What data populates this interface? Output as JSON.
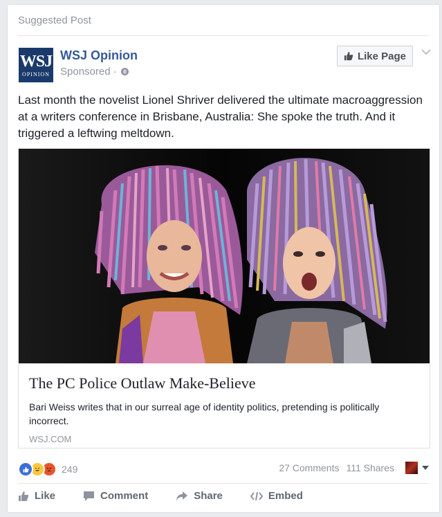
{
  "header": {
    "suggested_label": "Suggested Post"
  },
  "page": {
    "name": "WSJ Opinion",
    "logo_text": "WSJ",
    "logo_subtext": "OPINION",
    "sponsored_label": "Sponsored",
    "separator": "·",
    "like_page_label": "Like Page",
    "brand_color": "#365899",
    "logo_bg": "#1a3a6b"
  },
  "post": {
    "text": "Last month the novelist Lionel Shriver delivered the ultimate macroaggression at a writers conference in Brisbane, Australia: She spoke the truth. And it triggered a leftwing meltdown."
  },
  "link": {
    "title": "The PC Police Outlaw Make-Believe",
    "description": "Bari Weiss writes that in our surreal age of identity politics, pretending is politically incorrect.",
    "domain": "WSJ.COM",
    "image_icon": "photo-two-models-colorful-dreadlocks"
  },
  "engagement": {
    "reaction_count": "249",
    "comments": "27 Comments",
    "shares": "111 Shares",
    "reaction_icons": [
      "like-reaction-icon",
      "haha-reaction-icon",
      "angry-reaction-icon"
    ]
  },
  "actions": {
    "like": "Like",
    "comment": "Comment",
    "share": "Share",
    "embed": "Embed"
  },
  "icons": {
    "menu": "chevron-down-icon",
    "privacy": "globe-icon"
  }
}
